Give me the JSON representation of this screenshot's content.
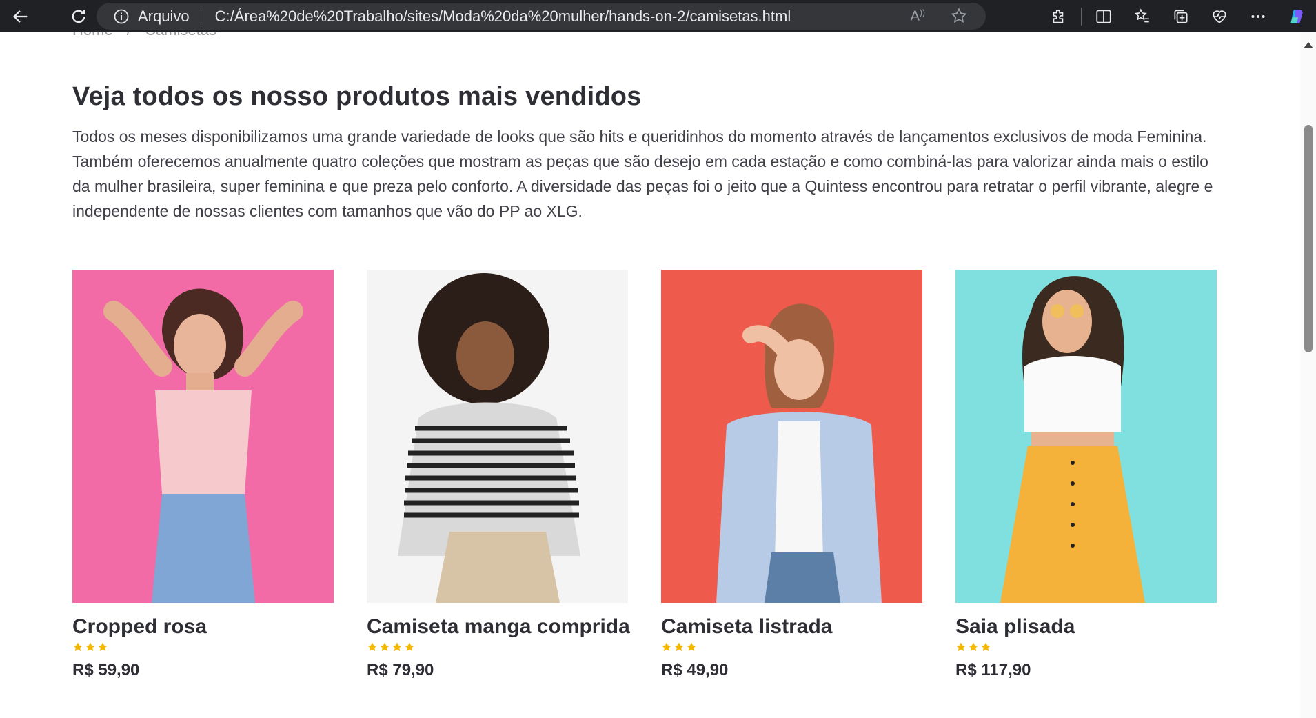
{
  "browser": {
    "scheme_label": "Arquivo",
    "url": "C:/Área%20de%20Trabalho/sites/Moda%20da%20mulher/hands-on-2/camisetas.html",
    "read_aloud_label": "A)"
  },
  "breadcrumb": {
    "home": "Home",
    "separator": "/",
    "current": "Camisetas"
  },
  "section": {
    "headline": "Veja todos os nosso produtos mais vendidos",
    "intro": "Todos os meses disponibilizamos uma grande variedade de looks que são hits e queridinhos do momento através de lançamentos exclusivos de moda Feminina. Também oferecemos anualmente quatro coleções que mostram as peças que são desejo em cada estação e como combiná-las para valorizar ainda mais o estilo da mulher brasileira, super feminina e que preza pelo conforto. A diversidade das peças foi o jeito que a Quintess encontrou para retratar o perfil vibrante, alegre e independente de nossas clientes com tamanhos que vão do PP ao XLG."
  },
  "products": [
    {
      "name": "Cropped rosa",
      "rating": 3,
      "price": "R$ 59,90",
      "bg_color": "#f26aa6"
    },
    {
      "name": "Camiseta manga comprida",
      "rating": 4,
      "price": "R$ 79,90",
      "bg_color": "#f4f4f4"
    },
    {
      "name": "Camiseta listrada",
      "rating": 3,
      "price": "R$ 49,90",
      "bg_color": "#ee5a4c"
    },
    {
      "name": "Saia plisada",
      "rating": 3,
      "price": "R$ 117,90",
      "bg_color": "#7fe0df"
    }
  ],
  "colors": {
    "star": "#f5b800",
    "heading": "#2e2e35",
    "chrome_bg": "#202124"
  }
}
